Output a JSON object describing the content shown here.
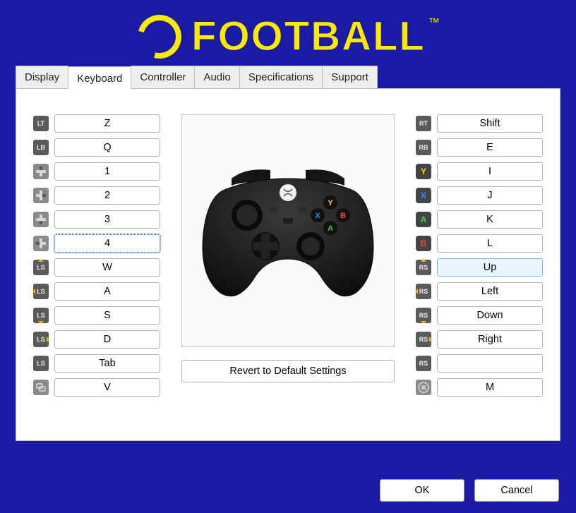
{
  "logo": {
    "text": "FOOTBALL",
    "tm": "™"
  },
  "tabs": [
    "Display",
    "Keyboard",
    "Controller",
    "Audio",
    "Specifications",
    "Support"
  ],
  "active_tab": 1,
  "left_bindings": [
    {
      "icon": "LT",
      "key": "Z"
    },
    {
      "icon": "LB",
      "key": "Q"
    },
    {
      "icon": "dpad-up",
      "key": "1"
    },
    {
      "icon": "dpad-right",
      "key": "2"
    },
    {
      "icon": "dpad-down",
      "key": "3"
    },
    {
      "icon": "dpad-left",
      "key": "4",
      "focused": true
    },
    {
      "icon": "LS",
      "arrow": "up",
      "key": "W"
    },
    {
      "icon": "LS",
      "arrow": "left",
      "key": "A"
    },
    {
      "icon": "LS",
      "arrow": "down",
      "key": "S"
    },
    {
      "icon": "LS",
      "arrow": "right",
      "key": "D"
    },
    {
      "icon": "LS",
      "key": "Tab"
    },
    {
      "icon": "view",
      "key": "V"
    }
  ],
  "right_bindings": [
    {
      "icon": "RT",
      "key": "Shift"
    },
    {
      "icon": "RB",
      "key": "E"
    },
    {
      "icon": "Y",
      "face": "y",
      "key": "I"
    },
    {
      "icon": "X",
      "face": "x",
      "key": "J"
    },
    {
      "icon": "A",
      "face": "a",
      "key": "K"
    },
    {
      "icon": "B",
      "face": "b",
      "key": "L"
    },
    {
      "icon": "RS",
      "arrow": "up",
      "key": "Up",
      "highlighted": true
    },
    {
      "icon": "RS",
      "arrow": "left",
      "key": "Left"
    },
    {
      "icon": "RS",
      "arrow": "down",
      "key": "Down"
    },
    {
      "icon": "RS",
      "arrow": "right",
      "key": "Right"
    },
    {
      "icon": "RS",
      "key": ""
    },
    {
      "icon": "menu",
      "key": "M"
    }
  ],
  "revert_label": "Revert to Default Settings",
  "buttons": {
    "ok": "OK",
    "cancel": "Cancel"
  }
}
